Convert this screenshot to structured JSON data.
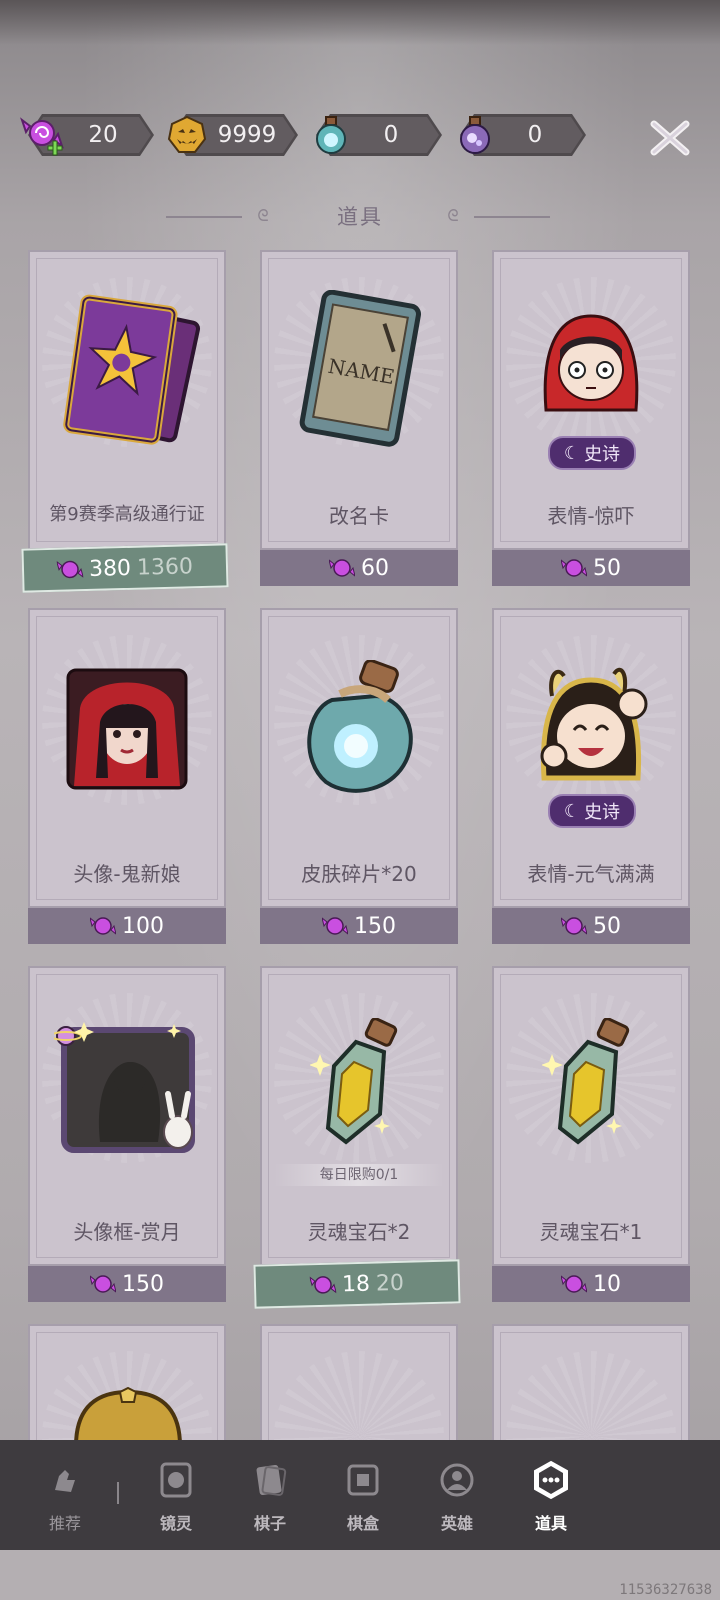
{
  "currencies": [
    {
      "icon": "candy-plus-icon",
      "value": "20"
    },
    {
      "icon": "pumpkin-coin-icon",
      "value": "9999"
    },
    {
      "icon": "blue-bottle-icon",
      "value": "0"
    },
    {
      "icon": "purple-bottle-icon",
      "value": "0"
    }
  ],
  "section_title": "道具",
  "items": [
    {
      "name": "第9赛季高级通行证",
      "price": "380",
      "original_price": "1360",
      "discount": true,
      "art": "pass-ticket-icon"
    },
    {
      "name": "改名卡",
      "price": "60",
      "discount": false,
      "art": "rename-card-icon"
    },
    {
      "name": "表情-惊吓",
      "price": "50",
      "discount": false,
      "badge": "史诗",
      "art": "red-hood-emote-icon"
    },
    {
      "name": "头像-鬼新娘",
      "price": "100",
      "discount": false,
      "art": "ghost-bride-avatar-icon"
    },
    {
      "name": "皮肤碎片*20",
      "price": "150",
      "discount": false,
      "art": "skin-shard-bottle-icon"
    },
    {
      "name": "表情-元气满满",
      "price": "50",
      "discount": false,
      "badge": "史诗",
      "art": "cheerful-emote-icon"
    },
    {
      "name": "头像框-赏月",
      "price": "150",
      "discount": false,
      "art": "moon-frame-icon"
    },
    {
      "name": "灵魂宝石*2",
      "price": "18",
      "original_price": "20",
      "discount": true,
      "limit": "每日限购0/1",
      "art": "soul-gem-icon"
    },
    {
      "name": "灵魂宝石*1",
      "price": "10",
      "discount": false,
      "art": "soul-gem-icon"
    }
  ],
  "nav": [
    {
      "label": "推荐",
      "icon": "recommend-icon"
    },
    {
      "label": "镜灵",
      "icon": "mirror-spirit-icon"
    },
    {
      "label": "棋子",
      "icon": "chess-piece-icon"
    },
    {
      "label": "棋盒",
      "icon": "chess-box-icon"
    },
    {
      "label": "英雄",
      "icon": "hero-icon"
    },
    {
      "label": "道具",
      "icon": "items-icon",
      "active": true
    }
  ],
  "watermark": "11536327638"
}
